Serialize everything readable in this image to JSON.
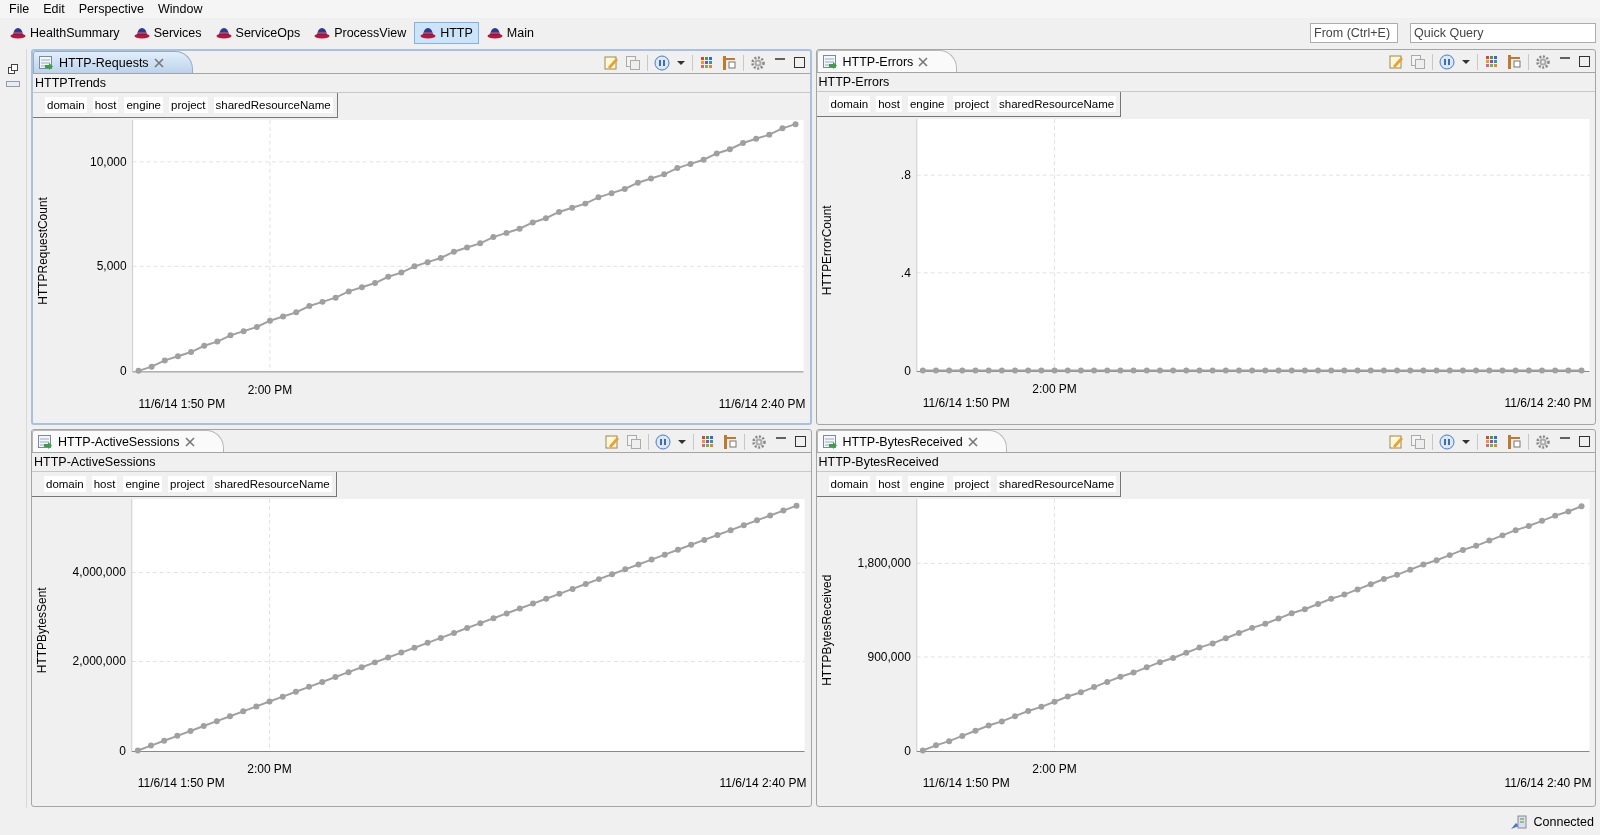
{
  "menu": [
    "File",
    "Edit",
    "Perspective",
    "Window"
  ],
  "perspectives": [
    {
      "label": "HealthSummary",
      "selected": false
    },
    {
      "label": "Services",
      "selected": false
    },
    {
      "label": "ServiceOps",
      "selected": false
    },
    {
      "label": "ProcessView",
      "selected": false
    },
    {
      "label": "HTTP",
      "selected": true
    },
    {
      "label": "Main",
      "selected": false
    }
  ],
  "search_fields": [
    {
      "placeholder": "From (Ctrl+E)"
    },
    {
      "placeholder": "Quick Query"
    }
  ],
  "panels": [
    {
      "tab": "HTTP-Requests",
      "active": true,
      "title": "HTTPTrends",
      "filters": [
        "domain",
        "host",
        "engine",
        "project",
        "sharedResourceName"
      ],
      "range_start": "11/6/14 1:50 PM",
      "range_end": "11/6/14 2:40 PM",
      "chart_data": {
        "type": "line",
        "grid": true,
        "ylabel": "HTTPRequestCount",
        "ylim": [
          0,
          12000
        ],
        "yticks": [
          {
            "value": 0,
            "label": "0"
          },
          {
            "value": 5000,
            "label": "5,000"
          },
          {
            "value": 10000,
            "label": "10,000"
          }
        ],
        "categories": [
          null,
          null,
          null,
          null,
          null,
          null,
          null,
          null,
          null,
          null,
          "2:00 PM",
          null,
          null,
          null,
          null,
          null,
          null,
          null,
          null,
          null,
          null,
          null,
          null,
          null,
          null,
          null,
          null,
          null,
          null,
          null,
          null,
          null,
          null,
          null,
          null,
          null,
          null,
          null,
          null,
          null,
          null,
          null,
          null,
          null,
          null,
          null,
          null,
          null,
          null,
          null,
          null
        ],
        "series": [
          {
            "color": "#a0a0a0",
            "marker": true,
            "values": [
              0,
              200,
              500,
              700,
              900,
              1200,
              1400,
              1700,
              1900,
              2100,
              2400,
              2600,
              2800,
              3100,
              3300,
              3500,
              3800,
              4000,
              4200,
              4500,
              4700,
              5000,
              5200,
              5400,
              5700,
              5900,
              6100,
              6400,
              6600,
              6800,
              7100,
              7300,
              7600,
              7800,
              8000,
              8300,
              8500,
              8700,
              9000,
              9200,
              9400,
              9700,
              9900,
              10100,
              10400,
              10600,
              10900,
              11100,
              11300,
              11600,
              11800
            ]
          }
        ]
      }
    },
    {
      "tab": "HTTP-Errors",
      "active": false,
      "title": "HTTP-Errors",
      "filters": [
        "domain",
        "host",
        "engine",
        "project",
        "sharedResourceName"
      ],
      "range_start": "11/6/14 1:50 PM",
      "range_end": "11/6/14 2:40 PM",
      "chart_data": {
        "type": "line",
        "grid": true,
        "ylabel": "HTTPErrorCount",
        "ylim": [
          0,
          1.03
        ],
        "yticks": [
          {
            "value": 0,
            "label": "0"
          },
          {
            "value": 0.4,
            "label": ".4"
          },
          {
            "value": 0.8,
            "label": ".8"
          }
        ],
        "categories": [
          null,
          null,
          null,
          null,
          null,
          null,
          null,
          null,
          null,
          null,
          "2:00 PM",
          null,
          null,
          null,
          null,
          null,
          null,
          null,
          null,
          null,
          null,
          null,
          null,
          null,
          null,
          null,
          null,
          null,
          null,
          null,
          null,
          null,
          null,
          null,
          null,
          null,
          null,
          null,
          null,
          null,
          null,
          null,
          null,
          null,
          null,
          null,
          null,
          null,
          null,
          null,
          null
        ],
        "series": [
          {
            "color": "#a0a0a0",
            "marker": true,
            "values": [
              0,
              0,
              0,
              0,
              0,
              0,
              0,
              0,
              0,
              0,
              0,
              0,
              0,
              0,
              0,
              0,
              0,
              0,
              0,
              0,
              0,
              0,
              0,
              0,
              0,
              0,
              0,
              0,
              0,
              0,
              0,
              0,
              0,
              0,
              0,
              0,
              0,
              0,
              0,
              0,
              0,
              0,
              0,
              0,
              0,
              0,
              0,
              0,
              0,
              0,
              0
            ]
          }
        ]
      }
    },
    {
      "tab": "HTTP-ActiveSessions",
      "active": false,
      "title": "HTTP-ActiveSessions",
      "filters": [
        "domain",
        "host",
        "engine",
        "project",
        "sharedResourceName"
      ],
      "range_start": "11/6/14 1:50 PM",
      "range_end": "11/6/14 2:40 PM",
      "chart_data": {
        "type": "line",
        "grid": true,
        "ylabel": "HTTPBytesSent",
        "ylim": [
          0,
          5650000
        ],
        "yticks": [
          {
            "value": 0,
            "label": "0"
          },
          {
            "value": 2000000,
            "label": "2,000,000"
          },
          {
            "value": 4000000,
            "label": "4,000,000"
          }
        ],
        "categories": [
          null,
          null,
          null,
          null,
          null,
          null,
          null,
          null,
          null,
          null,
          "2:00 PM",
          null,
          null,
          null,
          null,
          null,
          null,
          null,
          null,
          null,
          null,
          null,
          null,
          null,
          null,
          null,
          null,
          null,
          null,
          null,
          null,
          null,
          null,
          null,
          null,
          null,
          null,
          null,
          null,
          null,
          null,
          null,
          null,
          null,
          null,
          null,
          null,
          null,
          null,
          null,
          null
        ],
        "series": [
          {
            "color": "#a0a0a0",
            "marker": true,
            "values": [
              0,
              110000,
              220000,
              330000,
              440000,
              550000,
              660000,
              770000,
              880000,
              990000,
              1100000,
              1210000,
              1320000,
              1430000,
              1540000,
              1650000,
              1760000,
              1870000,
              1980000,
              2090000,
              2200000,
              2310000,
              2420000,
              2530000,
              2640000,
              2750000,
              2860000,
              2970000,
              3080000,
              3190000,
              3300000,
              3410000,
              3520000,
              3630000,
              3740000,
              3850000,
              3960000,
              4070000,
              4180000,
              4290000,
              4400000,
              4510000,
              4620000,
              4730000,
              4840000,
              4950000,
              5060000,
              5170000,
              5280000,
              5390000,
              5500000
            ]
          }
        ]
      }
    },
    {
      "tab": "HTTP-BytesReceived",
      "active": false,
      "title": "HTTP-BytesReceived",
      "filters": [
        "domain",
        "host",
        "engine",
        "project",
        "sharedResourceName"
      ],
      "range_start": "11/6/14 1:50 PM",
      "range_end": "11/6/14 2:40 PM",
      "chart_data": {
        "type": "line",
        "grid": true,
        "ylabel": "HTTPBytesReceived",
        "ylim": [
          0,
          2420000
        ],
        "yticks": [
          {
            "value": 0,
            "label": "0"
          },
          {
            "value": 900000,
            "label": "900,000"
          },
          {
            "value": 1800000,
            "label": "1,800,000"
          }
        ],
        "categories": [
          null,
          null,
          null,
          null,
          null,
          null,
          null,
          null,
          null,
          null,
          "2:00 PM",
          null,
          null,
          null,
          null,
          null,
          null,
          null,
          null,
          null,
          null,
          null,
          null,
          null,
          null,
          null,
          null,
          null,
          null,
          null,
          null,
          null,
          null,
          null,
          null,
          null,
          null,
          null,
          null,
          null,
          null,
          null,
          null,
          null,
          null,
          null,
          null,
          null,
          null,
          null,
          null
        ],
        "series": [
          {
            "color": "#a0a0a0",
            "marker": true,
            "values": [
              0,
              50000,
              90000,
              140000,
              190000,
              240000,
              280000,
              330000,
              380000,
              420000,
              470000,
              520000,
              560000,
              610000,
              660000,
              710000,
              750000,
              800000,
              850000,
              890000,
              940000,
              990000,
              1030000,
              1080000,
              1130000,
              1180000,
              1220000,
              1270000,
              1320000,
              1360000,
              1410000,
              1460000,
              1500000,
              1550000,
              1600000,
              1650000,
              1690000,
              1740000,
              1790000,
              1830000,
              1880000,
              1930000,
              1970000,
              2020000,
              2070000,
              2120000,
              2160000,
              2210000,
              2260000,
              2300000,
              2350000
            ]
          }
        ]
      }
    }
  ],
  "status_bar": {
    "text": "Connected"
  }
}
